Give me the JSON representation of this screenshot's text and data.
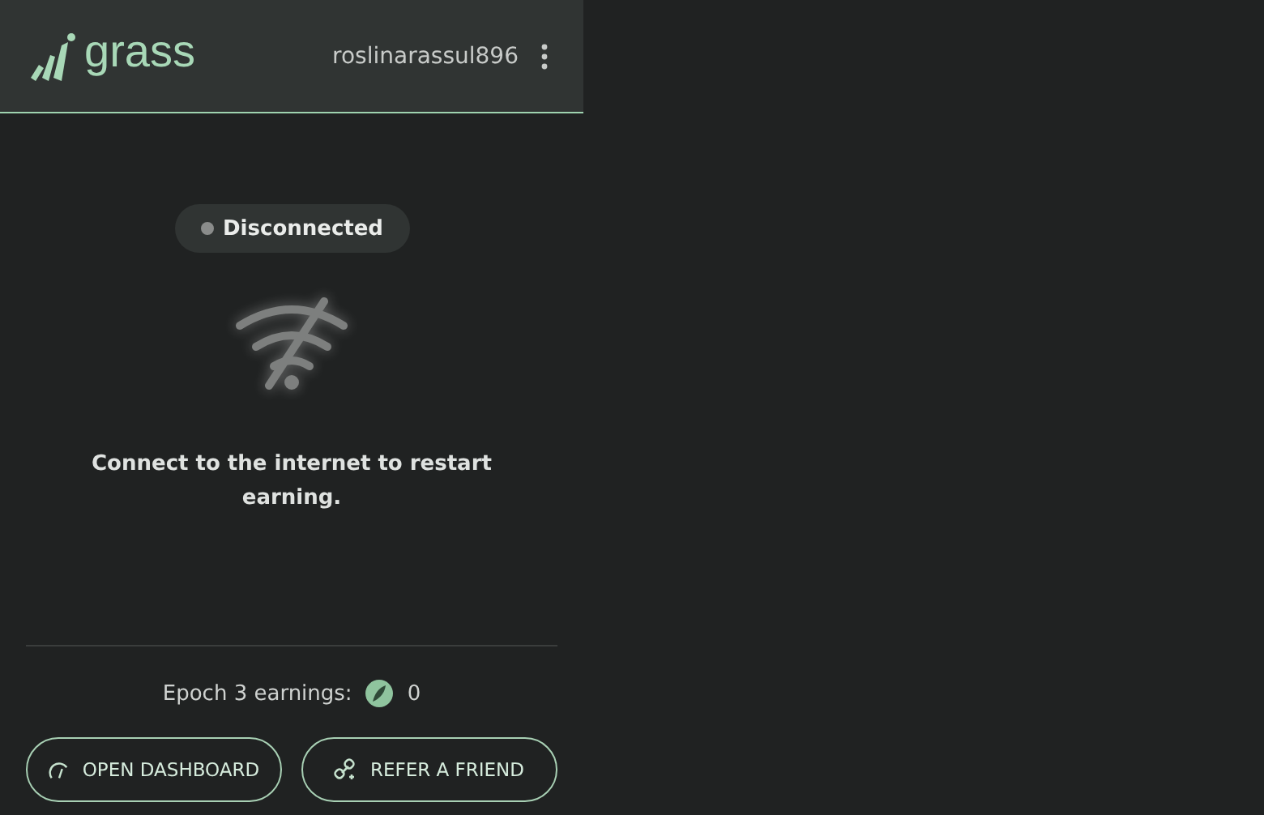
{
  "header": {
    "logo": "grass",
    "username": "roslinarassul896"
  },
  "status": {
    "label": "Disconnected",
    "connected": false
  },
  "message": "Connect to the internet to restart earning.",
  "earnings": {
    "label": "Epoch 3 earnings:",
    "value": "0"
  },
  "buttons": [
    {
      "label": "OPEN DASHBOARD",
      "kind": "dashboard"
    },
    {
      "label": "REFER A FRIEND",
      "kind": "refer"
    }
  ]
}
